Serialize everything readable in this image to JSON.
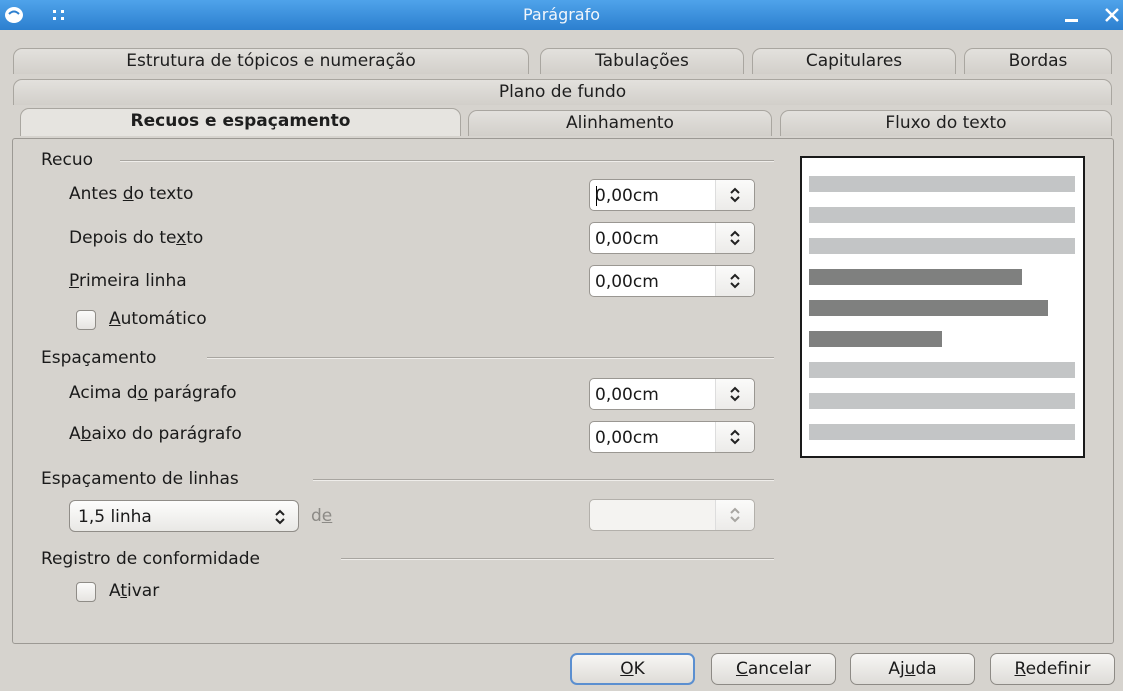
{
  "window": {
    "title": "Parágrafo"
  },
  "tabs_row1": [
    {
      "label": "Estrutura de tópicos e numeração"
    },
    {
      "label": "Tabulações"
    },
    {
      "label": "Capitulares"
    },
    {
      "label": "Bordas"
    }
  ],
  "tabs_row2": [
    {
      "label": "Plano de fundo"
    }
  ],
  "tabs_row3": [
    {
      "label": "Recuos e espaçamento"
    },
    {
      "label": "Alinhamento"
    },
    {
      "label": "Fluxo do texto"
    }
  ],
  "active_tab": "Recuos e espaçamento",
  "recuo": {
    "heading": "Recuo",
    "antes": {
      "pre": "Antes ",
      "mn": "d",
      "post": "o texto",
      "value": "0,00cm"
    },
    "depois": {
      "pre": "Depois do te",
      "mn": "x",
      "post": "to",
      "value": "0,00cm"
    },
    "primeira": {
      "pre": "",
      "mn": "P",
      "post": "rimeira linha",
      "value": "0,00cm"
    },
    "automatico": {
      "pre": "",
      "mn": "A",
      "post": "utomático",
      "checked": false
    }
  },
  "espacamento": {
    "heading": "Espaçamento",
    "acima": {
      "pre": "Acima d",
      "mn": "o",
      "post": " parágrafo",
      "value": "0,00cm"
    },
    "abaixo": {
      "pre": "A",
      "mn": "b",
      "post": "aixo do parágrafo",
      "value": "0,00cm"
    }
  },
  "linhas": {
    "heading": "Espaçamento de linhas",
    "selected": "1,5 linha",
    "de_pre": "d",
    "de_mn": "e",
    "value": ""
  },
  "registro": {
    "heading": "Registro de conformidade",
    "ativar": {
      "pre": "A",
      "mn": "t",
      "post": "ivar",
      "checked": false
    }
  },
  "preview": {
    "colors": {
      "context": "#c3c5c6",
      "current": "#7f807f"
    },
    "lines": [
      {
        "kind": "context",
        "width": 1.0
      },
      {
        "kind": "context",
        "width": 1.0
      },
      {
        "kind": "context",
        "width": 1.0
      },
      {
        "kind": "current",
        "width": 0.8
      },
      {
        "kind": "current",
        "width": 0.9
      },
      {
        "kind": "current",
        "width": 0.5
      },
      {
        "kind": "context",
        "width": 1.0
      },
      {
        "kind": "context",
        "width": 1.0
      },
      {
        "kind": "context",
        "width": 1.0
      }
    ]
  },
  "buttons": {
    "ok": {
      "pre": "",
      "mn": "O",
      "post": "K"
    },
    "cancelar": {
      "pre": "",
      "mn": "C",
      "post": "ancelar"
    },
    "ajuda": {
      "pre": "Aj",
      "mn": "u",
      "post": "da"
    },
    "redefinir": {
      "pre": "",
      "mn": "R",
      "post": "edefinir"
    }
  },
  "colors": {
    "titlebar": "#3a8fe0",
    "focus_border": "#5b8fd0"
  }
}
